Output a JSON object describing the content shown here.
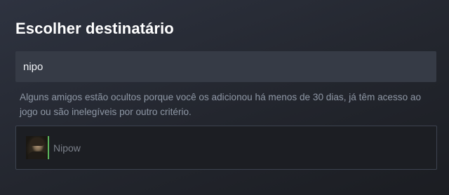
{
  "dialog": {
    "title": "Escolher destinatário"
  },
  "search": {
    "value": "nipo",
    "placeholder": ""
  },
  "notice": {
    "text": "Alguns amigos estão ocultos porque você os adicionou há menos de 30 dias, já têm acesso ao jogo ou são inelegíveis por outro critério."
  },
  "results": {
    "friends": [
      {
        "name": "Nipow",
        "status_color": "#5cb85c"
      }
    ]
  },
  "colors": {
    "background": "#23262e",
    "input_bg": "#363b46",
    "results_bg": "#1c1e23",
    "online_accent": "#5cb85c"
  }
}
